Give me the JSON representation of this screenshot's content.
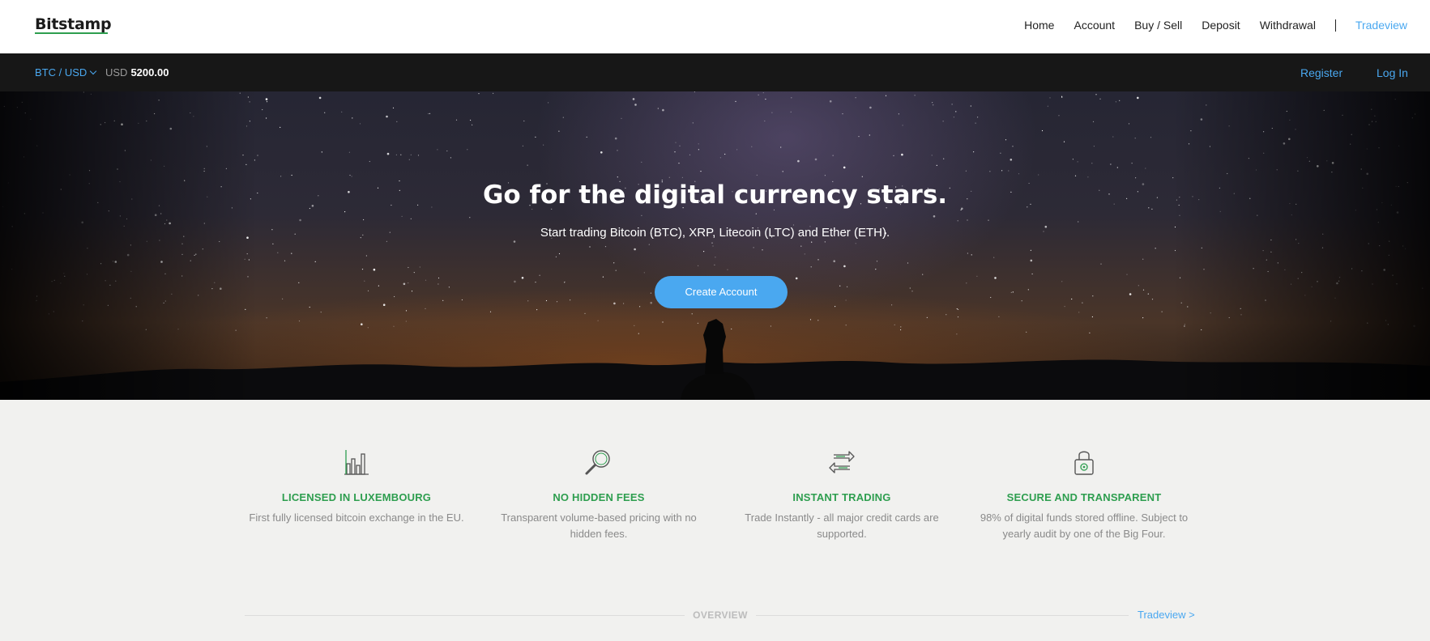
{
  "header": {
    "logo": "Bitstamp",
    "nav": [
      "Home",
      "Account",
      "Buy / Sell",
      "Deposit",
      "Withdrawal"
    ],
    "tradeview": "Tradeview"
  },
  "ticker": {
    "pair": "BTC / USD",
    "currency": "USD",
    "price": "5200.00",
    "register": "Register",
    "login": "Log In"
  },
  "hero": {
    "title": "Go for the digital currency stars.",
    "subtitle": "Start trading Bitcoin (BTC), XRP, Litecoin (LTC) and Ether (ETH).",
    "cta": "Create Account"
  },
  "features": [
    {
      "icon": "bar-chart-icon",
      "title": "LICENSED IN LUXEMBOURG",
      "text": "First fully licensed bitcoin exchange in the EU."
    },
    {
      "icon": "magnifier-icon",
      "title": "NO HIDDEN FEES",
      "text": "Transparent volume-based pricing with no hidden fees."
    },
    {
      "icon": "exchange-arrows-icon",
      "title": "INSTANT TRADING",
      "text": "Trade Instantly - all major credit cards are supported."
    },
    {
      "icon": "padlock-icon",
      "title": "SECURE AND TRANSPARENT",
      "text": "98% of digital funds stored offline. Subject to yearly audit by one of the Big Four."
    }
  ],
  "overview": {
    "label": "OVERVIEW",
    "link": "Tradeview >"
  },
  "colors": {
    "accent_blue": "#4aa8f0",
    "accent_green": "#2e9e4f",
    "dark_bar": "#171717"
  }
}
